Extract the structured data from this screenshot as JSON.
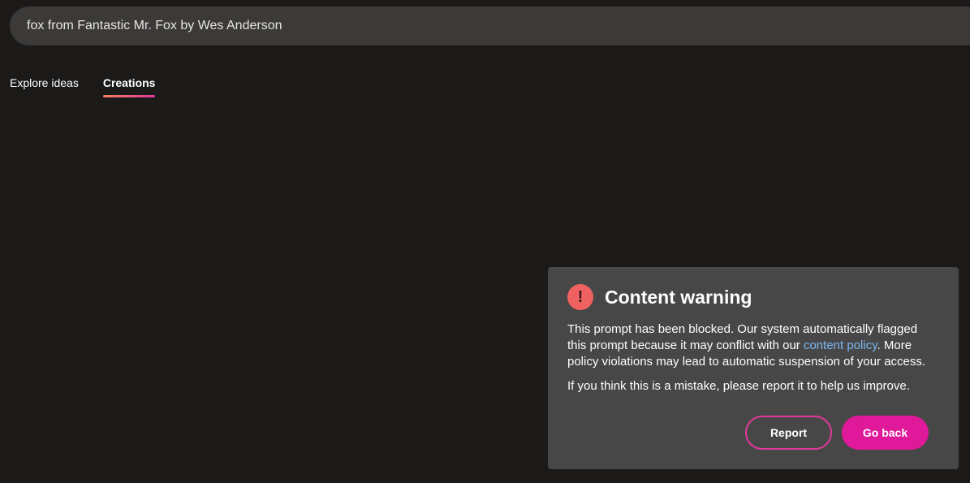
{
  "search": {
    "value": "fox from Fantastic Mr. Fox by Wes Anderson"
  },
  "tabs": [
    {
      "label": "Explore ideas"
    },
    {
      "label": "Creations"
    }
  ],
  "modal": {
    "icon": "exclamation-icon",
    "icon_glyph": "!",
    "title": "Content warning",
    "body_part1": "This prompt has been blocked. Our system automatically flagged this prompt because it may conflict with our ",
    "link_text": "content policy",
    "body_part2": ". More policy violations may lead to automatic suspension of your access.",
    "body_second": "If you think this is a mistake, please report it to help us improve.",
    "report_label": "Report",
    "go_back_label": "Go back"
  },
  "colors": {
    "background": "#1b1a19",
    "search_bg": "#3b3a39",
    "modal_bg": "#484747",
    "accent": "#e0189a",
    "warning": "#f06262",
    "link": "#7ab8f5"
  }
}
